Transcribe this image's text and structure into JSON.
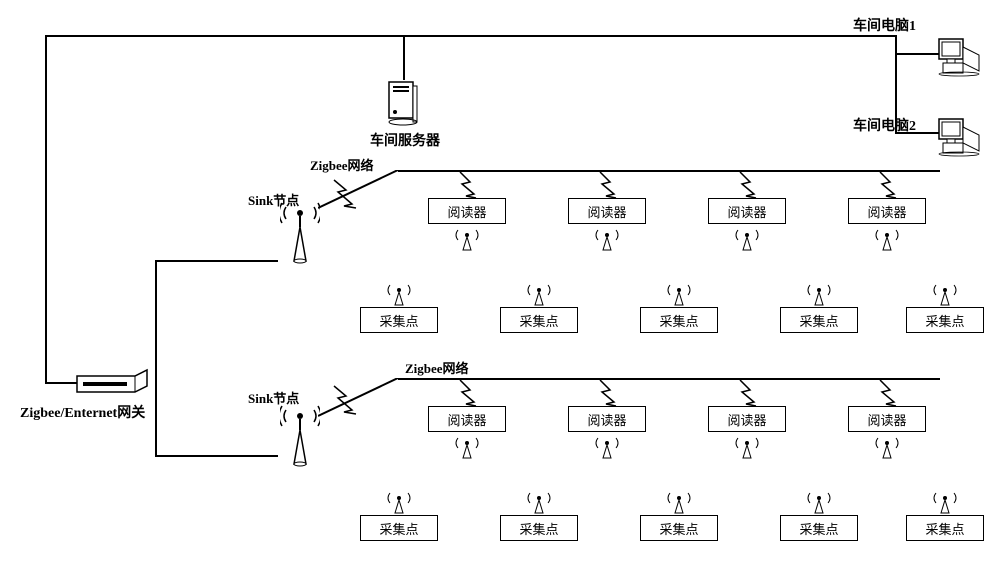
{
  "labels": {
    "workshop_server": "车间服务器",
    "workshop_pc1": "车间电脑1",
    "workshop_pc2": "车间电脑2",
    "gateway": "Zigbee/Enternet网关",
    "zigbee_network": "Zigbee网络",
    "sink_node": "Sink节点",
    "reader": "阅读器",
    "collection_point": "采集点"
  }
}
